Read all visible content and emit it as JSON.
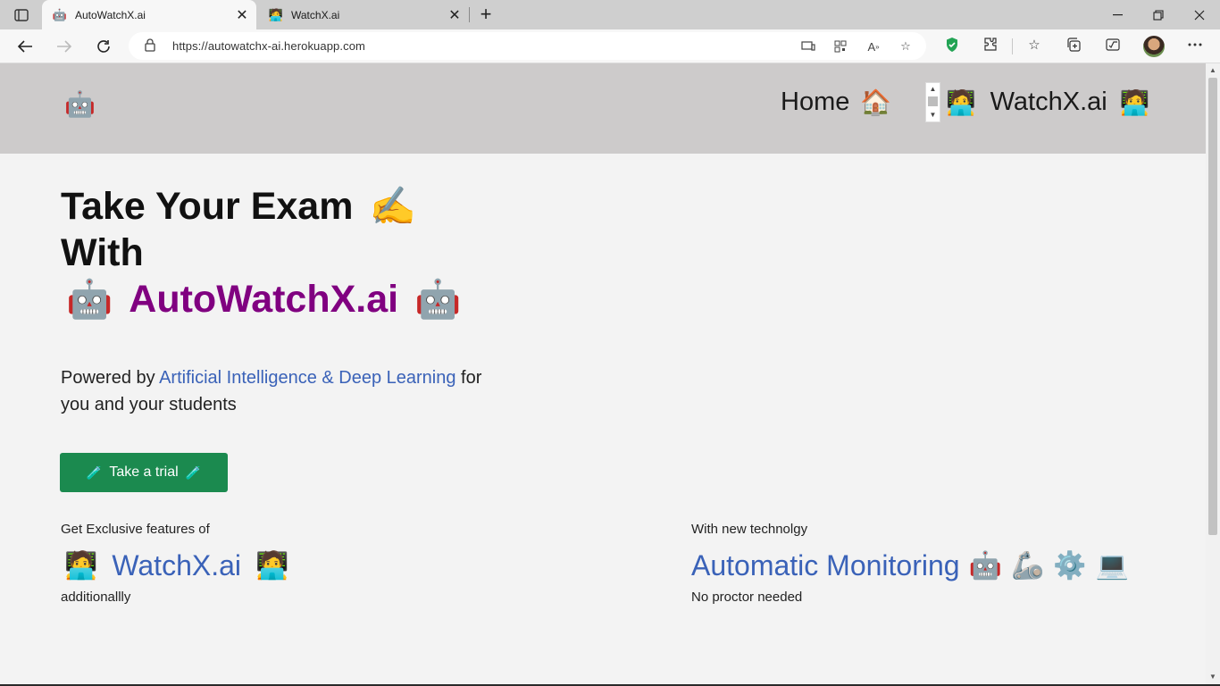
{
  "browser": {
    "tabs": [
      {
        "title": "AutoWatchX.ai",
        "favicon": "robot-icon",
        "active": true
      },
      {
        "title": "WatchX.ai",
        "favicon": "technologist-icon",
        "active": false
      }
    ],
    "url": "https://autowatchx-ai.herokuapp.com",
    "new_tab_glyph": "+",
    "close_glyph": "✕"
  },
  "header": {
    "logo": "🤖",
    "nav": [
      {
        "label": "Home",
        "icon": "🏠"
      },
      {
        "label": "WatchX.ai",
        "icon_left": "🧑‍💻",
        "icon_right": "🧑‍💻"
      }
    ]
  },
  "hero": {
    "line1": "Take Your Exam",
    "line1_emoji": "✍️",
    "line2": "With",
    "brand": "AutoWatchX.ai",
    "brand_emoji": "🤖",
    "powered_prefix": "Powered by ",
    "powered_link": "Artificial Intelligence & Deep Learning",
    "powered_suffix": " for you and your students"
  },
  "cta": {
    "label": "Take a trial",
    "icon": "🧪"
  },
  "features": [
    {
      "kicker": "Get Exclusive features of",
      "title": "WatchX.ai",
      "icons": [
        "🧑‍💻",
        "🧑‍💻"
      ],
      "sub": "additionallly"
    },
    {
      "kicker": "With new technolgy",
      "title": "Automatic Monitoring",
      "icons": [
        "🤖",
        "🦾",
        "⚙️",
        "💻"
      ],
      "sub": "No proctor needed"
    }
  ],
  "colors": {
    "brand_purple": "#800080",
    "link_blue": "#3a62b8",
    "cta_green": "#1b8a4f",
    "header_bg": "#cdcbcb",
    "page_bg": "#f3f3f3"
  }
}
